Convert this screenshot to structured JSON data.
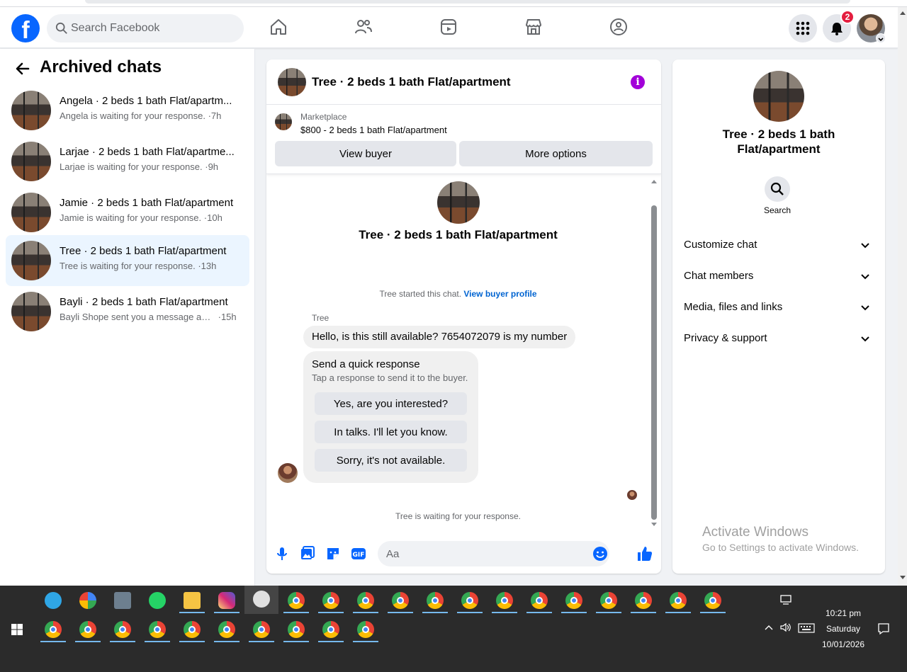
{
  "topnav": {
    "search_placeholder": "Search Facebook",
    "notification_count": "2"
  },
  "left": {
    "title": "Archived chats",
    "chats": [
      {
        "name": "Angela · 2 beds 1 bath Flat/apartm...",
        "preview": "Angela is waiting for your response.",
        "time": "·7h"
      },
      {
        "name": "Larjae · 2 beds 1 bath Flat/apartme...",
        "preview": "Larjae is waiting for your response.",
        "time": "·9h"
      },
      {
        "name": "Jamie · 2 beds 1 bath Flat/apartment",
        "preview": "Jamie is waiting for your response.",
        "time": "·10h"
      },
      {
        "name": "Tree · 2 beds 1 bath Flat/apartment",
        "preview": "Tree is waiting for your response.",
        "time": "·13h"
      },
      {
        "name": "Bayli · 2 beds 1 bath Flat/apartment",
        "preview": "Bayli Shope sent you a message abo...",
        "time": "·15h"
      }
    ]
  },
  "center": {
    "header_title": "Tree · 2 beds 1 bath Flat/apartment",
    "marketplace_label": "Marketplace",
    "listing": "$800 - 2 beds 1 bath Flat/apartment",
    "view_buyer": "View buyer",
    "more_options": "More options",
    "conv_title": "Tree · 2 beds 1 bath Flat/apartment",
    "started_text": "Tree started this chat.",
    "view_buyer_profile": "View buyer profile",
    "sender": "Tree",
    "message": "Hello, is this still available? 7654072079 is my number",
    "quick_title": "Send a quick response",
    "quick_sub": "Tap a response to send it to the buyer.",
    "quick_replies": [
      "Yes, are you interested?",
      "In talks. I'll let you know.",
      "Sorry, it's not available."
    ],
    "waiting": "Tree is waiting for your response.",
    "composer_placeholder": "Aa"
  },
  "right": {
    "title": "Tree · 2 beds 1 bath Flat/apartment",
    "search_label": "Search",
    "sections": [
      "Customize chat",
      "Chat members",
      "Media, files and links",
      "Privacy & support"
    ]
  },
  "watermark": {
    "line1": "Activate Windows",
    "line2": "Go to Settings to activate Windows."
  },
  "taskbar": {
    "time": "10:21 pm",
    "day": "Saturday",
    "date": "10/01/2026"
  },
  "colors": {
    "fb_blue": "#0866ff",
    "accent_purple": "#a200d9",
    "active_chat_bg": "#ebf5ff",
    "badge_red": "#e41e3f"
  }
}
